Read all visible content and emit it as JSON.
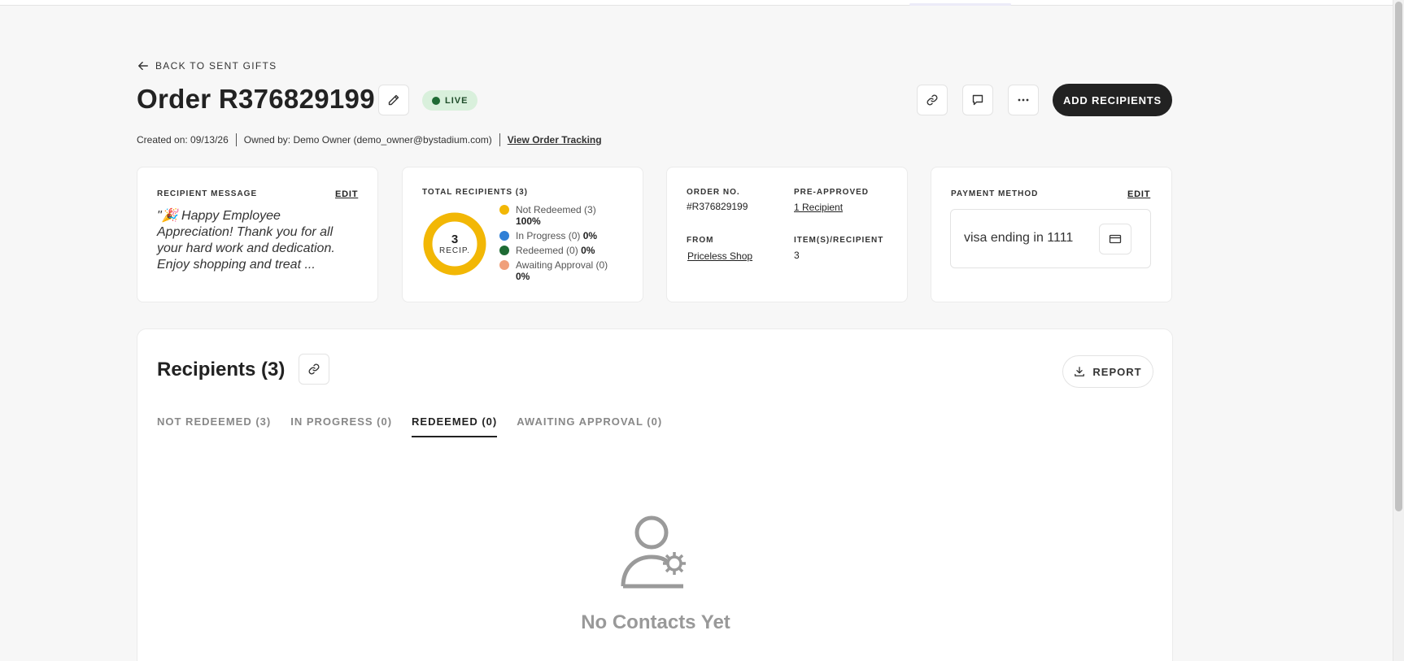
{
  "header": {
    "back_label": "BACK TO SENT GIFTS",
    "order_title": "Order R376829199",
    "status_badge": "LIVE",
    "add_recipients_label": "ADD RECIPIENTS",
    "created_on": "Created on: 09/13/26",
    "owned_by": "Owned by: Demo Owner (demo_owner@bystadium.com)",
    "tracking_link": "View Order Tracking"
  },
  "message_card": {
    "label": "RECIPIENT MESSAGE",
    "edit_label": "EDIT",
    "text": "\"🎉 Happy Employee Appreciation! Thank you for all your hard work and dedication. Enjoy shopping and treat ..."
  },
  "recipients_card": {
    "label": "TOTAL RECIPIENTS (3)",
    "center_number": "3",
    "center_unit": "RECIP.",
    "legend": [
      {
        "label": "Not Redeemed (3)",
        "pct": "100%",
        "color": "#f2b705",
        "value": 3
      },
      {
        "label": "In Progress (0)",
        "pct": "0%",
        "color": "#2f7fd6",
        "value": 0
      },
      {
        "label": "Redeemed (0)",
        "pct": "0%",
        "color": "#1e6b34",
        "value": 0
      },
      {
        "label": "Awaiting Approval (0)",
        "pct": "0%",
        "color": "#f0a07a",
        "value": 0
      }
    ]
  },
  "order_card": {
    "order_no_label": "ORDER NO.",
    "order_no": "#R376829199",
    "pre_approved_label": "PRE-APPROVED",
    "pre_approved": "1 Recipient",
    "from_label": "FROM",
    "from": "Priceless Shop",
    "items_label": "ITEM(S)/RECIPIENT",
    "items": "3"
  },
  "payment_card": {
    "label": "PAYMENT METHOD",
    "edit_label": "EDIT",
    "method": "visa ending in 1111"
  },
  "recipients_panel": {
    "title": "Recipients (3)",
    "report_label": "REPORT",
    "tabs": [
      {
        "label": "NOT REDEEMED (3)",
        "active": false
      },
      {
        "label": "IN PROGRESS (0)",
        "active": false
      },
      {
        "label": "REDEEMED (0)",
        "active": true
      },
      {
        "label": "AWAITING APPROVAL (0)",
        "active": false
      }
    ],
    "empty_text": "No Contacts Yet"
  }
}
